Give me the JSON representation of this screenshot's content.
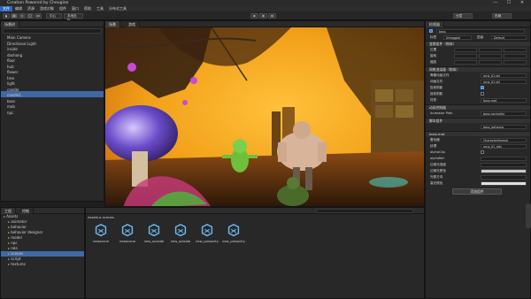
{
  "window": {
    "title": "Creation Powered by Cheugine",
    "min_glyph": "—",
    "max_glyph": "☐",
    "close_glyph": "✕"
  },
  "menu": [
    "文件",
    "编辑",
    "资源",
    "游戏对象",
    "组件",
    "窗口",
    "帮助",
    "工具",
    "分布式工具"
  ],
  "toolbar": {
    "pivot_label": "中心",
    "local_label": "本地坐标",
    "layers_label": "分层",
    "layout_label": "布局"
  },
  "hierarchy": {
    "tab": "场景树",
    "items": [
      "Main Camera",
      "Directional Light",
      "inside",
      "dashang",
      "floor",
      "hub",
      "flower",
      "tree",
      "light",
      "candle",
      "candle1",
      "boss",
      "mob",
      "npc"
    ],
    "selected_index": 11
  },
  "scene": {
    "tabs": [
      "场景",
      "游戏"
    ]
  },
  "inspector": {
    "tab": "检视器",
    "object_name": "boss",
    "tag_label": "标签",
    "tag_value": "Untagged",
    "layer_label": "层级",
    "layer_value": "Default",
    "transform": "变换组件（物体）",
    "position": "位置",
    "rotation": "旋转",
    "scale": "缩放",
    "mesh_renderer": "网格渲染器（物体）",
    "mesh_file": "骨骼动画文件",
    "mesh_value1": "orna_01.skl",
    "anim_file": "动画文件",
    "mesh_value2": "orna_01.skl",
    "cast_shadow": "投射阴影",
    "receive_shadow": "接收阴影",
    "material_label": "材质",
    "material_value": "boss.mat",
    "animator_section": "动画控制器",
    "animator_path_label": "Animator Path",
    "animator_path_value": "boss.controller",
    "script_section": "脚本组件",
    "script_value": "boss_behavior",
    "material_section": "boss.mat",
    "shader_label": "着色器",
    "shader_value": "CharacterNormal",
    "texture_label": "纹理",
    "texture_value": "orna_01_dds",
    "alpha_cutoff": "alphaClip",
    "alpha_ref": "alphaRef",
    "rim_power": "边缘光强度",
    "rim_color": "边缘光颜色",
    "light_dir": "光照方向",
    "spec_color": "高光颜色",
    "add_component": "添加组件"
  },
  "project": {
    "tabs": [
      "工程",
      "控制"
    ],
    "tree": [
      "Assets",
      "animator",
      "behavior",
      "behavior designer",
      "model",
      "npc",
      "role",
      "scenes",
      "script",
      "textures"
    ],
    "selected_index": 7
  },
  "assets": {
    "breadcrumb": [
      "Assets",
      "scenes"
    ],
    "items": [
      "newscene",
      "newscene",
      "new_outside",
      "new_outside",
      "new_presocity",
      "new_presocity"
    ]
  },
  "colors": {
    "accent": "#3e69a8",
    "scene_sky": "#f2a019",
    "unity_icon": "#6fb7f0"
  }
}
